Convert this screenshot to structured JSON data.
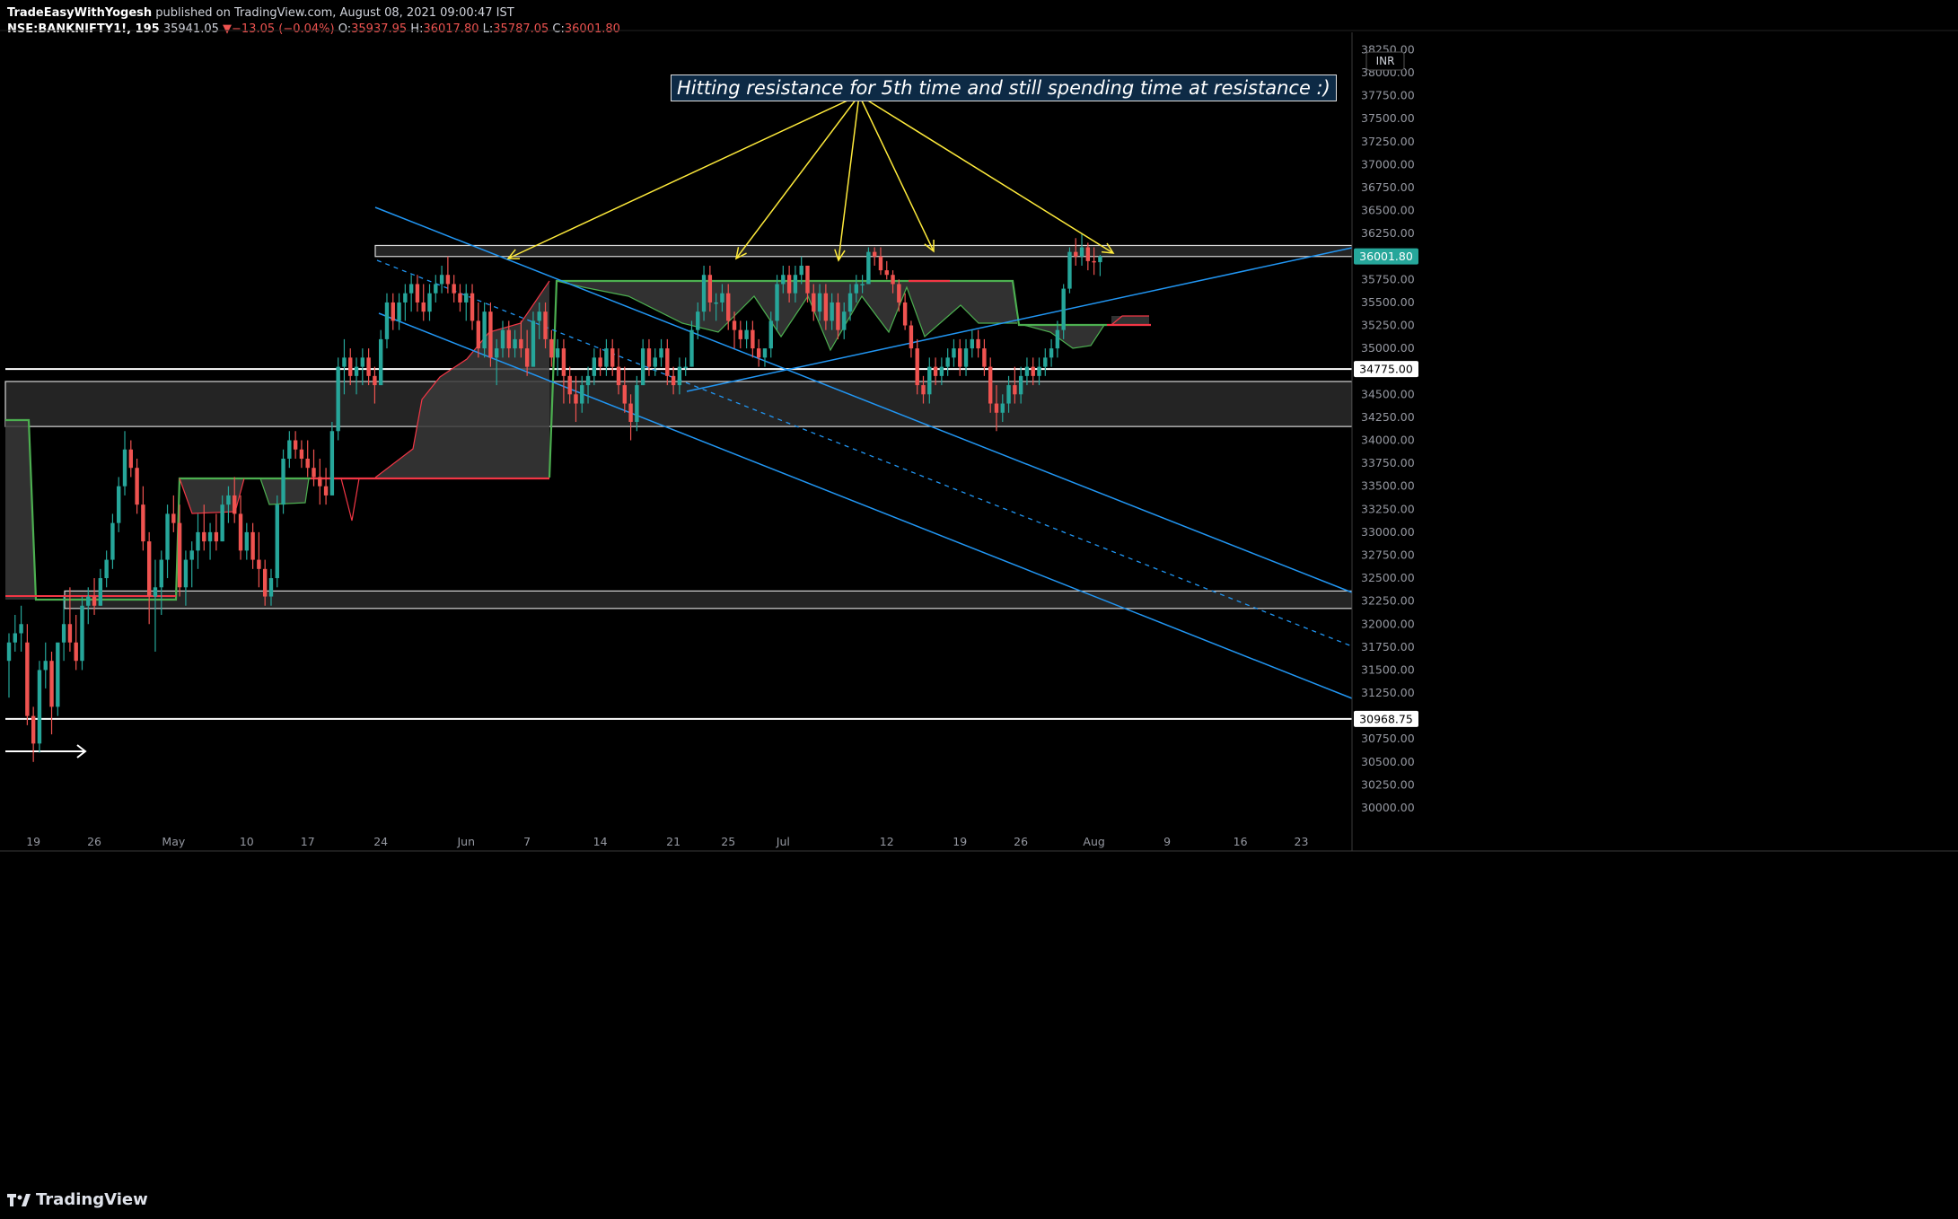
{
  "header": {
    "author": "TradeEasyWithYogesh",
    "published_text": "published on TradingView.com, August 08, 2021 09:00:47 IST",
    "symbol": "NSE:BANKNIFTY1!, 195",
    "last": "35941.05",
    "change": "▼−13.05 (−0.04%)",
    "o_label": "O:",
    "o": "35937.95",
    "h_label": "H:",
    "h": "36017.80",
    "l_label": "L:",
    "l": "35787.05",
    "c_label": "C:",
    "c": "36001.80"
  },
  "footer": {
    "brand": "TradingView",
    "logo_icon": "tradingview-logo-icon"
  },
  "currency_badge": "INR",
  "annotation": "Hitting resistance for 5th time and still spending time at resistance :)",
  "colors": {
    "bull": "#26a69a",
    "bear": "#ef5350",
    "trend": "#2196f3",
    "arrows": "#ffeb3b",
    "kijun_green": "#4caf50",
    "kijun_red": "#f23645",
    "zone_fill": "#2a2a2a",
    "background": "#000000"
  },
  "chart_data": {
    "type": "candlestick",
    "ylim": [
      29850,
      38300
    ],
    "y_ticks": [
      30000,
      30250,
      30500,
      30750,
      31000,
      31250,
      31500,
      31750,
      32000,
      32250,
      32500,
      32750,
      33000,
      33250,
      33500,
      33750,
      34000,
      34250,
      34500,
      34750,
      35000,
      35250,
      35500,
      35750,
      36000,
      36250,
      36500,
      36750,
      37000,
      37250,
      37500,
      37750,
      38000,
      38250
    ],
    "y_tick_labels": [
      "30000.00",
      "30250.00",
      "30500.00",
      "30750.00",
      "31000.00",
      "31250.00",
      "31500.00",
      "31750.00",
      "32000.00",
      "32250.00",
      "32500.00",
      "32750.00",
      "33000.00",
      "33250.00",
      "33500.00",
      "33750.00",
      "34000.00",
      "34250.00",
      "34500.00",
      "34750.00",
      "35000.00",
      "35250.00",
      "35500.00",
      "35750.00",
      "36000.00",
      "36250.00",
      "36500.00",
      "36750.00",
      "37000.00",
      "37250.00",
      "37500.00",
      "37750.00",
      "38000.00",
      "38250.00"
    ],
    "x_ticks": [
      {
        "label": "19",
        "bar": 4
      },
      {
        "label": "26",
        "bar": 14
      },
      {
        "label": "May",
        "bar": 27
      },
      {
        "label": "10",
        "bar": 39
      },
      {
        "label": "17",
        "bar": 49
      },
      {
        "label": "24",
        "bar": 61
      },
      {
        "label": "Jun",
        "bar": 75
      },
      {
        "label": "7",
        "bar": 85
      },
      {
        "label": "14",
        "bar": 97
      },
      {
        "label": "21",
        "bar": 109
      },
      {
        "label": "25",
        "bar": 118
      },
      {
        "label": "Jul",
        "bar": 127
      },
      {
        "label": "12",
        "bar": 144
      },
      {
        "label": "19",
        "bar": 156
      },
      {
        "label": "26",
        "bar": 166
      },
      {
        "label": "Aug",
        "bar": 178
      },
      {
        "label": "9",
        "bar": 190
      },
      {
        "label": "16",
        "bar": 202
      },
      {
        "label": "23",
        "bar": 212
      }
    ],
    "price_labels": [
      {
        "value": 36001.8,
        "text": "36001.80",
        "style": "last"
      },
      {
        "value": 34775.0,
        "text": "34775.00",
        "style": "line"
      },
      {
        "value": 30968.75,
        "text": "30968.75",
        "style": "line"
      }
    ],
    "candles": [
      [
        31600,
        31900,
        31200,
        31800
      ],
      [
        31800,
        32100,
        31700,
        31900
      ],
      [
        31900,
        32200,
        31700,
        32000
      ],
      [
        31800,
        32000,
        30900,
        31000
      ],
      [
        31000,
        31100,
        30500,
        30700
      ],
      [
        30700,
        31600,
        30600,
        31500
      ],
      [
        31500,
        31800,
        31300,
        31600
      ],
      [
        31600,
        31700,
        30800,
        31100
      ],
      [
        31100,
        31700,
        31000,
        31800
      ],
      [
        31800,
        32300,
        31600,
        32000
      ],
      [
        32000,
        32400,
        31700,
        31800
      ],
      [
        31800,
        32100,
        31500,
        31600
      ],
      [
        31600,
        32300,
        31500,
        32200
      ],
      [
        32200,
        32400,
        32000,
        32300
      ],
      [
        32300,
        32500,
        32100,
        32200
      ],
      [
        32200,
        32600,
        32200,
        32500
      ],
      [
        32500,
        32800,
        32400,
        32700
      ],
      [
        32700,
        33200,
        32600,
        33100
      ],
      [
        33100,
        33600,
        33000,
        33500
      ],
      [
        33500,
        34100,
        33400,
        33900
      ],
      [
        33900,
        34000,
        33600,
        33700
      ],
      [
        33700,
        33800,
        33200,
        33300
      ],
      [
        33300,
        33500,
        32800,
        32900
      ],
      [
        32900,
        33000,
        32000,
        32300
      ],
      [
        32300,
        32700,
        31700,
        32400
      ],
      [
        32400,
        32800,
        32100,
        32700
      ],
      [
        32700,
        33300,
        32500,
        33200
      ],
      [
        33200,
        33400,
        33000,
        33100
      ],
      [
        33100,
        33300,
        32300,
        32400
      ],
      [
        32400,
        32800,
        32200,
        32700
      ],
      [
        32700,
        32900,
        32400,
        32800
      ],
      [
        32800,
        33200,
        32600,
        33000
      ],
      [
        33000,
        33300,
        32800,
        32900
      ],
      [
        32900,
        33100,
        32700,
        33000
      ],
      [
        33000,
        33200,
        32800,
        32900
      ],
      [
        32900,
        33400,
        32900,
        33300
      ],
      [
        33300,
        33500,
        33100,
        33400
      ],
      [
        33400,
        33600,
        33100,
        33200
      ],
      [
        33200,
        33400,
        32700,
        32800
      ],
      [
        32800,
        33100,
        32700,
        33000
      ],
      [
        33000,
        33100,
        32600,
        32700
      ],
      [
        32700,
        33000,
        32400,
        32600
      ],
      [
        32600,
        32700,
        32200,
        32300
      ],
      [
        32300,
        32600,
        32200,
        32500
      ],
      [
        32500,
        33400,
        32400,
        33300
      ],
      [
        33300,
        33900,
        33200,
        33800
      ],
      [
        33800,
        34100,
        33700,
        34000
      ],
      [
        34000,
        34100,
        33800,
        33900
      ],
      [
        33900,
        34000,
        33700,
        33800
      ],
      [
        33800,
        34000,
        33600,
        33700
      ],
      [
        33700,
        33900,
        33500,
        33600
      ],
      [
        33600,
        33800,
        33300,
        33500
      ],
      [
        33500,
        33700,
        33300,
        33400
      ],
      [
        33400,
        34200,
        33400,
        34100
      ],
      [
        34100,
        34900,
        34000,
        34800
      ],
      [
        34800,
        35100,
        34500,
        34900
      ],
      [
        34900,
        35000,
        34600,
        34700
      ],
      [
        34700,
        34900,
        34500,
        34800
      ],
      [
        34800,
        35000,
        34600,
        34900
      ],
      [
        34900,
        35000,
        34600,
        34700
      ],
      [
        34700,
        34800,
        34400,
        34600
      ],
      [
        34600,
        35200,
        34600,
        35100
      ],
      [
        35100,
        35600,
        35000,
        35500
      ],
      [
        35500,
        35600,
        35200,
        35300
      ],
      [
        35300,
        35600,
        35200,
        35500
      ],
      [
        35500,
        35700,
        35300,
        35600
      ],
      [
        35600,
        35800,
        35400,
        35700
      ],
      [
        35700,
        35800,
        35400,
        35500
      ],
      [
        35500,
        35700,
        35300,
        35400
      ],
      [
        35400,
        35700,
        35300,
        35600
      ],
      [
        35600,
        35800,
        35500,
        35700
      ],
      [
        35700,
        35900,
        35600,
        35800
      ],
      [
        35800,
        36000,
        35600,
        35700
      ],
      [
        35700,
        35800,
        35500,
        35600
      ],
      [
        35600,
        35700,
        35400,
        35500
      ],
      [
        35500,
        35700,
        35300,
        35600
      ],
      [
        35600,
        35700,
        35200,
        35300
      ],
      [
        35300,
        35500,
        34900,
        35000
      ],
      [
        35000,
        35500,
        34900,
        35400
      ],
      [
        35400,
        35500,
        34800,
        34900
      ],
      [
        34900,
        35100,
        34600,
        35000
      ],
      [
        35000,
        35300,
        34900,
        35200
      ],
      [
        35200,
        35300,
        34900,
        35000
      ],
      [
        35000,
        35200,
        34900,
        35100
      ],
      [
        35100,
        35300,
        34900,
        35000
      ],
      [
        35000,
        35200,
        34700,
        34800
      ],
      [
        34800,
        35400,
        34800,
        35300
      ],
      [
        35300,
        35500,
        35100,
        35400
      ],
      [
        35400,
        35500,
        35000,
        35100
      ],
      [
        35100,
        35200,
        34800,
        34900
      ],
      [
        34900,
        35100,
        34700,
        35000
      ],
      [
        35000,
        35100,
        34400,
        34700
      ],
      [
        34700,
        34800,
        34400,
        34500
      ],
      [
        34500,
        34700,
        34200,
        34400
      ],
      [
        34400,
        34700,
        34300,
        34600
      ],
      [
        34600,
        34800,
        34400,
        34700
      ],
      [
        34700,
        35000,
        34600,
        34900
      ],
      [
        34900,
        35000,
        34700,
        34800
      ],
      [
        34800,
        35100,
        34700,
        35000
      ],
      [
        35000,
        35100,
        34700,
        34800
      ],
      [
        34800,
        35000,
        34500,
        34600
      ],
      [
        34600,
        34800,
        34300,
        34400
      ],
      [
        34400,
        34500,
        34000,
        34200
      ],
      [
        34200,
        34700,
        34100,
        34600
      ],
      [
        34600,
        35100,
        34600,
        35000
      ],
      [
        35000,
        35100,
        34700,
        34800
      ],
      [
        34800,
        35000,
        34700,
        34900
      ],
      [
        34900,
        35100,
        34800,
        35000
      ],
      [
        35000,
        35100,
        34600,
        34700
      ],
      [
        34700,
        34800,
        34500,
        34600
      ],
      [
        34600,
        34900,
        34500,
        34800
      ],
      [
        34800,
        34900,
        34700,
        34800
      ],
      [
        34800,
        35300,
        34800,
        35200
      ],
      [
        35200,
        35500,
        35100,
        35400
      ],
      [
        35400,
        35900,
        35300,
        35800
      ],
      [
        35800,
        35900,
        35400,
        35500
      ],
      [
        35500,
        35600,
        35300,
        35500
      ],
      [
        35500,
        35700,
        35400,
        35600
      ],
      [
        35600,
        35700,
        35200,
        35300
      ],
      [
        35300,
        35400,
        35000,
        35200
      ],
      [
        35200,
        35300,
        35000,
        35100
      ],
      [
        35100,
        35300,
        35000,
        35200
      ],
      [
        35200,
        35300,
        34900,
        35000
      ],
      [
        35000,
        35100,
        34800,
        34900
      ],
      [
        34900,
        35000,
        34800,
        35000
      ],
      [
        35000,
        35400,
        34900,
        35300
      ],
      [
        35300,
        35800,
        35200,
        35700
      ],
      [
        35700,
        35900,
        35600,
        35800
      ],
      [
        35800,
        35900,
        35500,
        35600
      ],
      [
        35600,
        35900,
        35500,
        35800
      ],
      [
        35800,
        36000,
        35700,
        35900
      ],
      [
        35900,
        35900,
        35500,
        35600
      ],
      [
        35600,
        35700,
        35300,
        35400
      ],
      [
        35400,
        35700,
        35300,
        35600
      ],
      [
        35600,
        35700,
        35200,
        35300
      ],
      [
        35300,
        35600,
        35200,
        35500
      ],
      [
        35500,
        35600,
        35100,
        35200
      ],
      [
        35200,
        35500,
        35100,
        35400
      ],
      [
        35400,
        35700,
        35300,
        35600
      ],
      [
        35600,
        35800,
        35500,
        35700
      ],
      [
        35700,
        35800,
        35600,
        35700
      ],
      [
        35700,
        36100,
        35700,
        36050
      ],
      [
        36050,
        36100,
        35900,
        36000
      ],
      [
        36000,
        36100,
        35800,
        35850
      ],
      [
        35850,
        35950,
        35750,
        35800
      ],
      [
        35800,
        35850,
        35600,
        35700
      ],
      [
        35700,
        35750,
        35400,
        35500
      ],
      [
        35500,
        35600,
        35200,
        35250
      ],
      [
        35250,
        35300,
        34900,
        35000
      ],
      [
        35000,
        35100,
        34500,
        34600
      ],
      [
        34600,
        34700,
        34400,
        34500
      ],
      [
        34500,
        34900,
        34400,
        34800
      ],
      [
        34800,
        34900,
        34600,
        34700
      ],
      [
        34700,
        34900,
        34600,
        34800
      ],
      [
        34800,
        35000,
        34700,
        34900
      ],
      [
        34900,
        35100,
        34800,
        35000
      ],
      [
        35000,
        35100,
        34700,
        34800
      ],
      [
        34800,
        35100,
        34700,
        35000
      ],
      [
        35000,
        35200,
        34900,
        35100
      ],
      [
        35100,
        35200,
        34900,
        35000
      ],
      [
        35000,
        35100,
        34700,
        34800
      ],
      [
        34800,
        34900,
        34300,
        34400
      ],
      [
        34400,
        34600,
        34100,
        34300
      ],
      [
        34300,
        34500,
        34200,
        34400
      ],
      [
        34400,
        34700,
        34300,
        34600
      ],
      [
        34600,
        34800,
        34400,
        34500
      ],
      [
        34500,
        34800,
        34400,
        34700
      ],
      [
        34700,
        34900,
        34600,
        34800
      ],
      [
        34800,
        34900,
        34600,
        34700
      ],
      [
        34700,
        34900,
        34600,
        34800
      ],
      [
        34800,
        35000,
        34700,
        34900
      ],
      [
        34900,
        35100,
        34800,
        35000
      ],
      [
        35000,
        35300,
        34900,
        35200
      ],
      [
        35200,
        35700,
        35100,
        35650
      ],
      [
        35650,
        36100,
        35600,
        36050
      ],
      [
        36050,
        36200,
        35900,
        36000
      ],
      [
        36000,
        36250,
        35900,
        36100
      ],
      [
        36100,
        36150,
        35850,
        35950
      ],
      [
        35950,
        36100,
        35800,
        35941
      ],
      [
        35938,
        36018,
        35787,
        36002
      ]
    ]
  }
}
